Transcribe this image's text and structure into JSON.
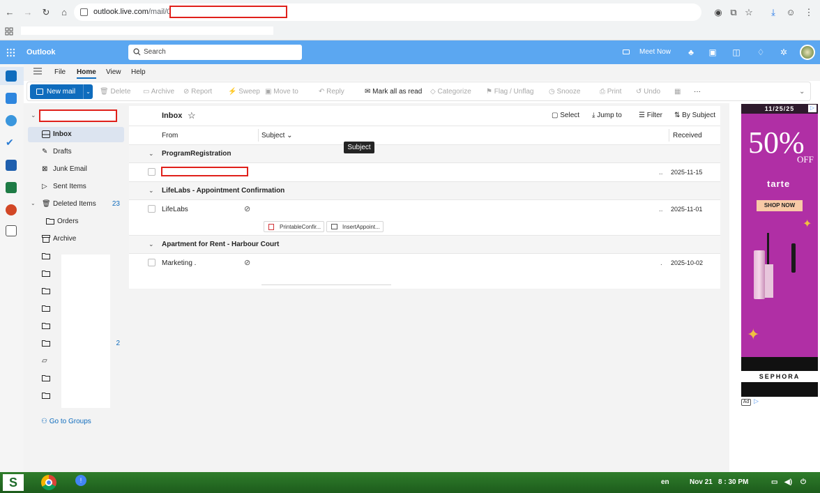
{
  "browser": {
    "url_host": "outlook.live.com",
    "url_path": "/mail/0/"
  },
  "header": {
    "app_name": "Outlook",
    "search_placeholder": "Search",
    "meet_now": "Meet Now"
  },
  "ribbon_tabs": [
    "File",
    "Home",
    "View",
    "Help"
  ],
  "ribbon": {
    "new_mail": "New mail",
    "delete": "Delete",
    "archive": "Archive",
    "report": "Report",
    "sweep": "Sweep",
    "move_to": "Move to",
    "reply": "Reply",
    "mark_all_read": "Mark all as read",
    "categorize": "Categorize",
    "flag": "Flag / Unflag",
    "snooze": "Snooze",
    "print": "Print",
    "undo": "Undo",
    "more": "···"
  },
  "folders": {
    "inbox": "Inbox",
    "drafts": "Drafts",
    "junk": "Junk Email",
    "sent": "Sent Items",
    "deleted": "Deleted Items",
    "deleted_count": "23",
    "orders": "Orders",
    "archive": "Archive",
    "hidden_count": "2",
    "go_to_groups": "Go to Groups"
  },
  "list": {
    "title": "Inbox",
    "select": "Select",
    "jump_to": "Jump to",
    "filter": "Filter",
    "sort": "By Subject",
    "col_from": "From",
    "col_subject": "Subject",
    "col_received": "Received",
    "tooltip": "Subject",
    "groups": [
      {
        "name": "ProgramRegistration",
        "from": "",
        "date": "2025-11-15"
      },
      {
        "name": "LifeLabs - Appointment Confirmation",
        "from": "LifeLabs",
        "date": "2025-11-01",
        "attachments": [
          "PrintableConfir...",
          "InsertAppoint..."
        ]
      },
      {
        "name": "Apartment for Rent - Harbour Court",
        "from": "Marketing .",
        "date": "2025-10-02"
      }
    ]
  },
  "ad": {
    "date": "11/25/25",
    "discount": "50%",
    "off": "OFF",
    "brand": "tarte",
    "cta": "SHOP NOW",
    "retailer": "SEPHORA",
    "ad_label": "Ad"
  },
  "taskbar": {
    "lang": "en",
    "date": "Nov 21",
    "time": "8 : 30 PM"
  },
  "colors": {
    "outlook_blue": "#5ba7f1",
    "accent": "#0f6cbd",
    "redaction": "#e0201a"
  }
}
